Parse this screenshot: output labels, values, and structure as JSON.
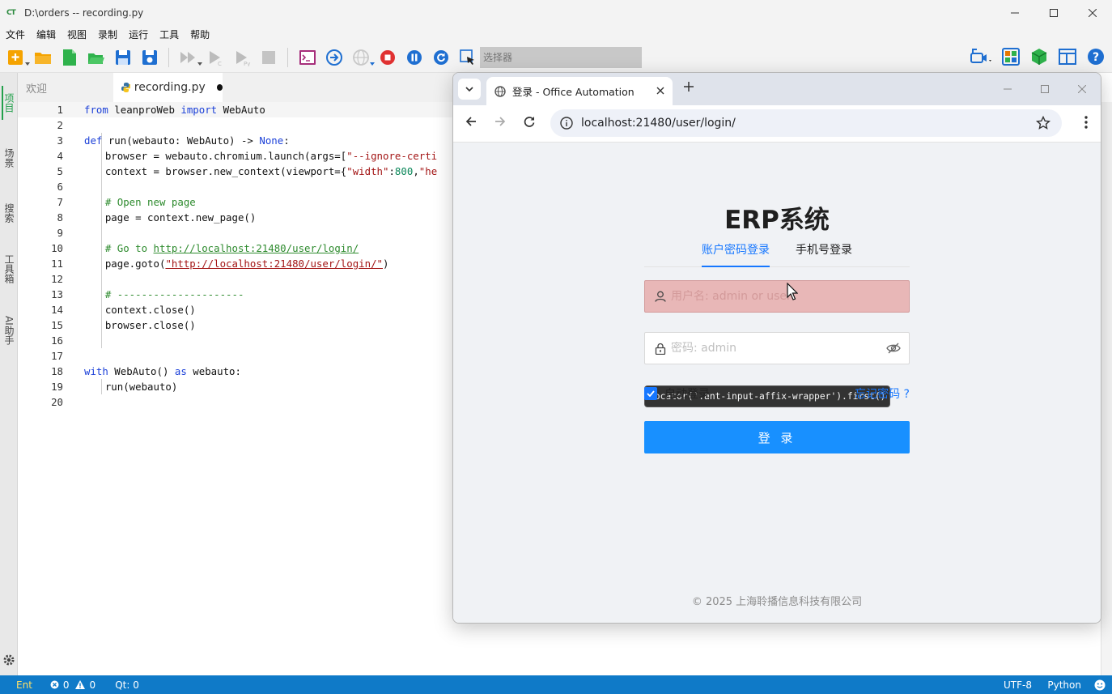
{
  "ide": {
    "title": "D:\\orders -- recording.py",
    "logo": "CT",
    "menu": [
      "文件",
      "编辑",
      "视图",
      "录制",
      "运行",
      "工具",
      "帮助"
    ],
    "selector_placeholder": "选择器",
    "side_tabs": [
      "项目",
      "场景",
      "搜索",
      "工具箱",
      "AI助手"
    ],
    "tabs": [
      {
        "label": "欢迎"
      },
      {
        "label": "recording.py",
        "modified": true
      }
    ],
    "line_numbers": [
      "1",
      "2",
      "3",
      "4",
      "5",
      "6",
      "7",
      "8",
      "9",
      "10",
      "11",
      "12",
      "13",
      "14",
      "15",
      "16",
      "17",
      "18",
      "19",
      "20"
    ],
    "code": {
      "l1a": "from",
      "l1b": " leanproWeb ",
      "l1c": "import",
      "l1d": " WebAuto",
      "l3a": "def",
      "l3b": " run(webauto: WebAuto) -> ",
      "l3c": "None",
      "l4a": "    browser = webauto.chromium.launch(args=[",
      "l4b": "\"--ignore-certi",
      "l5a": "    context = browser.new_context(viewport={",
      "l5b": "\"width\"",
      "l5c": ":",
      "l5d": "800",
      "l5e": ",",
      "l5f": "\"he",
      "l7": "    # Open new page",
      "l8": "    page = context.new_page()",
      "l10a": "    # Go to ",
      "l10b": "http://localhost:21480/user/login/",
      "l11a": "    page.goto(",
      "l11b": "\"http://localhost:21480/user/login/\"",
      "l11c": ")",
      "l13": "    # ---------------------",
      "l14": "    context.close()",
      "l15": "    browser.close()",
      "l18a": "with",
      "l18b": " WebAuto() ",
      "l18c": "as",
      "l18d": " webauto:",
      "l19": "    run(webauto)"
    },
    "status": {
      "mode": "Ent",
      "errors": "0",
      "warnings": "0",
      "qt": "Qt: 0",
      "encoding": "UTF-8",
      "language": "Python"
    },
    "colors": {
      "status_bar": "#0f7ac8",
      "accent_green": "#22a04b"
    }
  },
  "browser": {
    "tab_title": "登录 - Office Automation",
    "url": "localhost:21480/user/login/",
    "page": {
      "title": "ERP系统",
      "login_tabs": [
        "账户密码登录",
        "手机号登录"
      ],
      "username_placeholder": "用户名: admin or user",
      "password_placeholder": "密码: admin",
      "remember_label": "自动登录",
      "remember_checked": true,
      "forgot_label": "忘记密码 ?",
      "login_button": "登 录",
      "footer": "© 2025 上海聆播信息科技有限公司",
      "tooltip": "locator('.ant-input-affix-wrapper').first()"
    },
    "colors": {
      "primary": "#1677ff",
      "button": "#1890ff",
      "highlight": "#e8b7b7"
    }
  }
}
